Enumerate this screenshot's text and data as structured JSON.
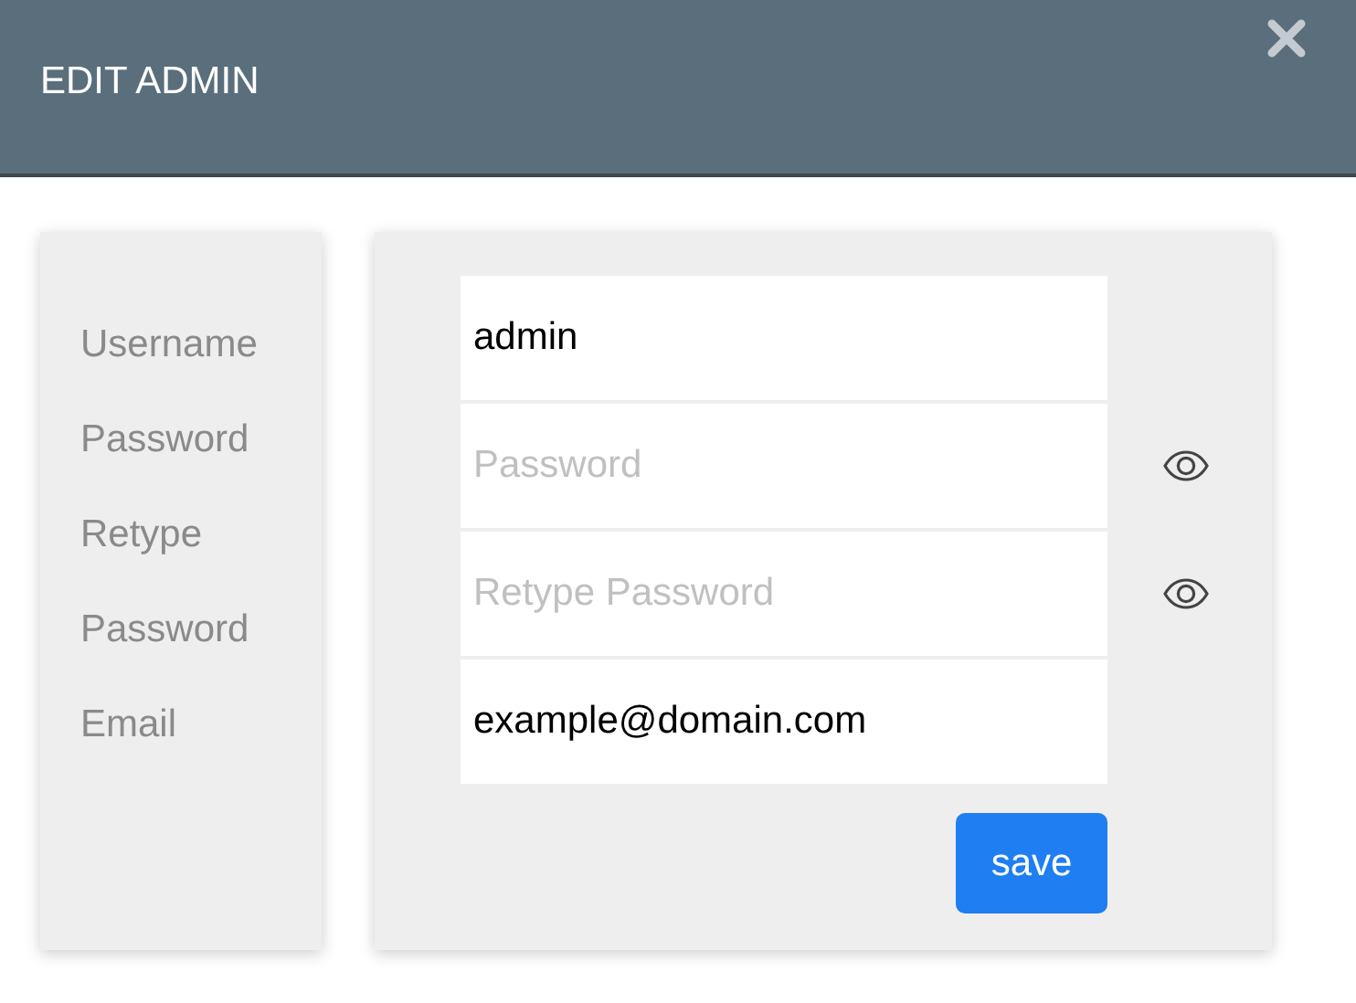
{
  "window": {
    "title": "EDIT ADMIN"
  },
  "labels": [
    "Username",
    "Password",
    "Retype Password",
    "Email"
  ],
  "fields": [
    {
      "value": "admin",
      "reveal_toggle": false
    },
    {
      "placeholder": "Password",
      "reveal_toggle": true
    },
    {
      "placeholder": "Retype Password",
      "reveal_toggle": true
    },
    {
      "value": "example@domain.com",
      "reveal_toggle": false
    }
  ],
  "save_button": "save"
}
